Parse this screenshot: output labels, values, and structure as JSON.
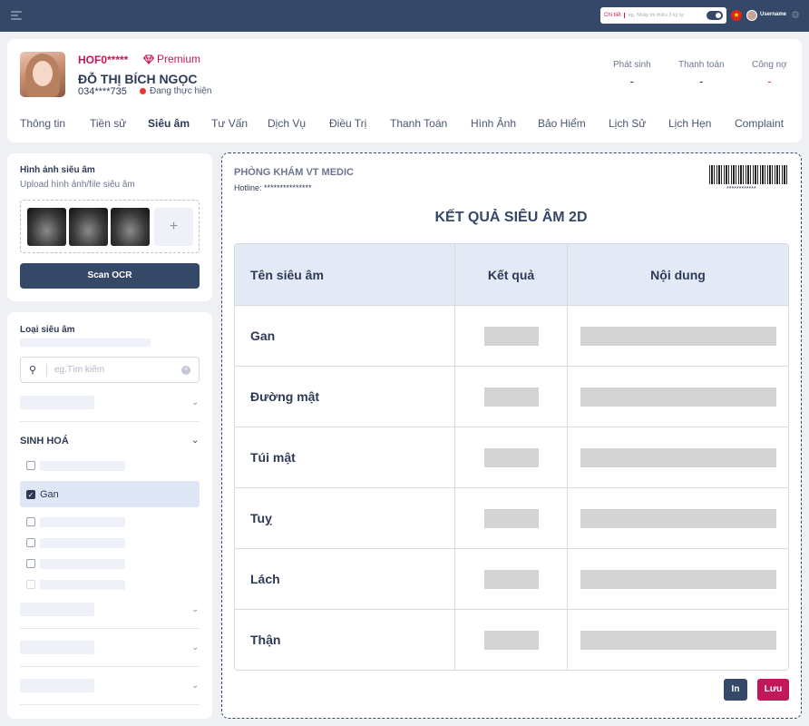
{
  "topbar": {
    "search_tag": "Chi tiết",
    "search_placeholder": "eg. Nhập tối thiểu 3 ký tự",
    "username": "Username",
    "menu_icon": "menu-icon",
    "gear_icon": "gear-icon"
  },
  "patient": {
    "code": "HOF0*****",
    "tier": "Premium",
    "name": "ĐỖ THỊ BÍCH NGỌC",
    "phone": "034****735",
    "status": "Đang thực hiện",
    "finance": [
      {
        "label": "Phát sinh",
        "value": "-"
      },
      {
        "label": "Thanh toán",
        "value": "-"
      },
      {
        "label": "Công nợ",
        "value": "-"
      }
    ]
  },
  "tabs": [
    "Thông tin",
    "Tiền sử",
    "Siêu âm",
    "Tư Vấn",
    "Dịch Vụ",
    "Điều Trị",
    "Thanh Toán",
    "Hình Ảnh",
    "Bảo Hiểm",
    "Lịch Sử",
    "Lịch Hẹn",
    "Complaint"
  ],
  "active_tab": "Siêu âm",
  "upload": {
    "title": "Hình ảnh siêu âm",
    "subtitle": "Upload hình ảnh/file siêu âm",
    "add_symbol": "+",
    "scan_button": "Scan OCR"
  },
  "type_panel": {
    "title": "Loại siêu âm",
    "search_placeholder": "eg.Tìm kiếm",
    "section": "SINH HOÁ",
    "checked_item": "Gan"
  },
  "result": {
    "clinic": "PHÒNG KHÁM VT MEDIC",
    "hotline": "Hotline: ***************",
    "barcode_number": "************",
    "title": "KẾT QUẢ SIÊU ÂM 2D",
    "columns": [
      "Tên siêu âm",
      "Kết quả",
      "Nội dung"
    ],
    "rows": [
      "Gan",
      "Đường mật",
      "Túi mật",
      "Tuỵ",
      "Lách",
      "Thận"
    ],
    "print_button": "In",
    "save_button": "Lưu"
  },
  "colors": {
    "navy": "#354867",
    "accent_pink": "#c2185b",
    "status_red": "#e53935"
  }
}
